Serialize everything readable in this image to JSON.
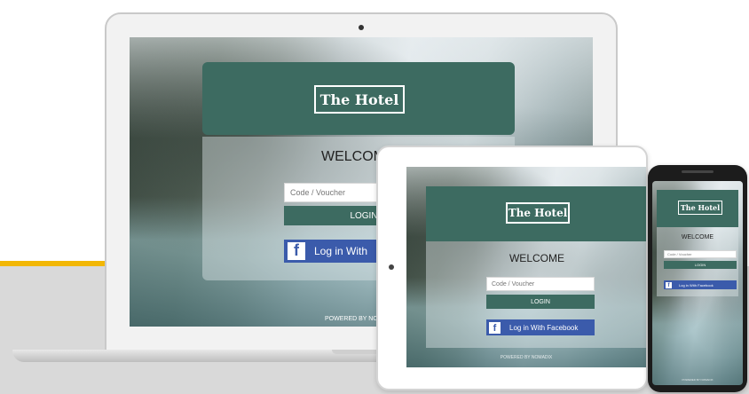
{
  "login": {
    "brand": "The Hotel",
    "welcome": "WELCOME",
    "voucher_placeholder": "Code / Voucher",
    "login_label": "LOGIN",
    "facebook_label": "Log in With Facebook",
    "facebook_icon": "f",
    "powered_by": "POWERED BY NOMADIX"
  },
  "laptop": {
    "welcome_visible": "WELCOM",
    "facebook_visible": "Log in With",
    "powered_visible": "POWERED BY NO"
  },
  "colors": {
    "banner_green": "#3d6b61",
    "facebook_blue": "#3b5bab",
    "accent_yellow": "#f2b705"
  }
}
